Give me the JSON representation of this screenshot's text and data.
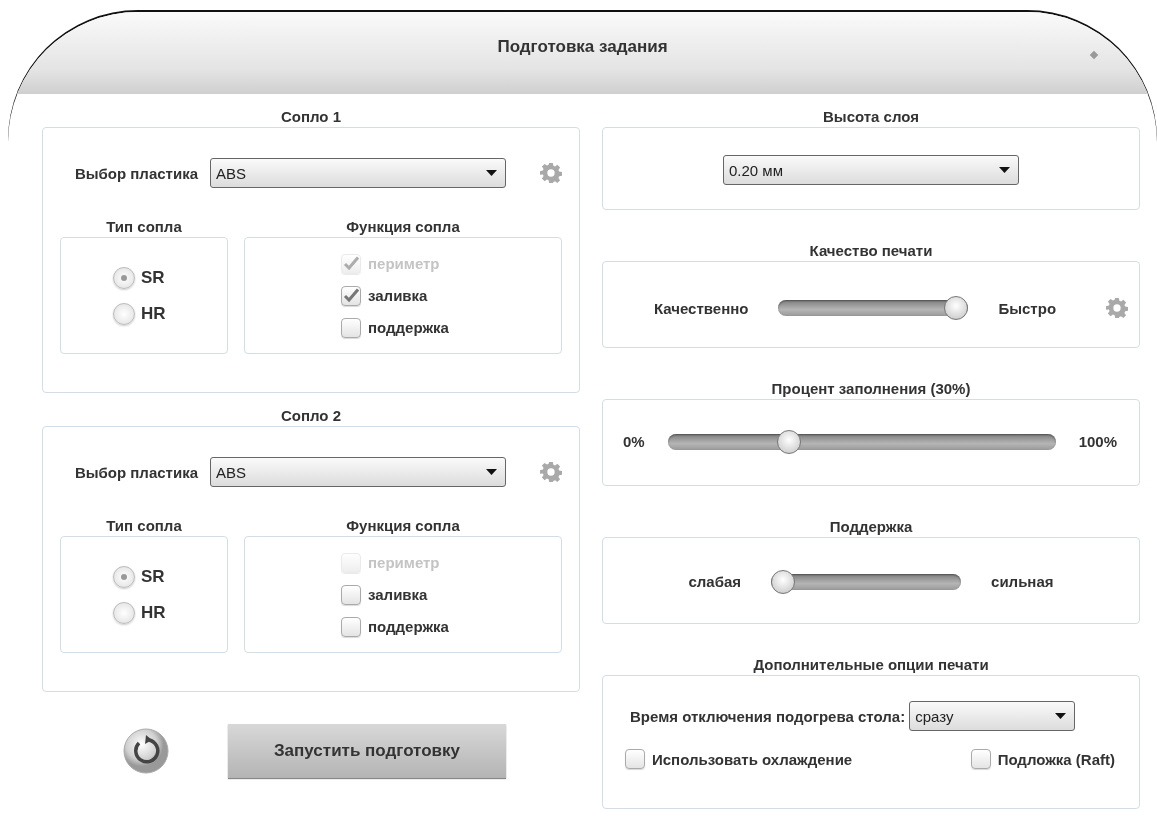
{
  "window": {
    "title": "Подготовка задания"
  },
  "nozzles": [
    {
      "title": "Сопло 1",
      "material_label": "Выбор пластика",
      "material": "ABS",
      "type_title": "Тип сопла",
      "types": [
        {
          "label": "SR",
          "selected": true
        },
        {
          "label": "HR",
          "selected": false
        }
      ],
      "function_title": "Функция сопла",
      "functions": [
        {
          "label": "периметр",
          "checked": true,
          "disabled": true
        },
        {
          "label": "заливка",
          "checked": true,
          "disabled": false
        },
        {
          "label": "поддержка",
          "checked": false,
          "disabled": false
        }
      ]
    },
    {
      "title": "Сопло 2",
      "material_label": "Выбор пластика",
      "material": "ABS",
      "type_title": "Тип сопла",
      "types": [
        {
          "label": "SR",
          "selected": true
        },
        {
          "label": "HR",
          "selected": false
        }
      ],
      "function_title": "Функция сопла",
      "functions": [
        {
          "label": "периметр",
          "checked": false,
          "disabled": true
        },
        {
          "label": "заливка",
          "checked": false,
          "disabled": false
        },
        {
          "label": "поддержка",
          "checked": false,
          "disabled": false
        }
      ]
    }
  ],
  "layer_height": {
    "title": "Высота слоя",
    "value": "0.20 мм"
  },
  "sliders": [
    {
      "title": "Качество печати",
      "min_label": "Качественно",
      "max_label": "Быстро",
      "level": 1.0
    },
    {
      "title": "Процент заполнения (30%)",
      "min_label": "0%",
      "max_label": "100%",
      "level": 0.3
    },
    {
      "title": "Поддержка",
      "min_label": "слабая",
      "max_label": "сильная",
      "level": 0.0
    }
  ],
  "extra_options": {
    "title": "Дополнительные опции печати",
    "bed_label": "Время отключения подогрева стола:",
    "bed_value": "сразу",
    "options": [
      {
        "label": "Использовать охлаждение",
        "checked": false
      },
      {
        "label": "Подложка (Raft)",
        "checked": false
      }
    ]
  },
  "actions": {
    "start_label": "Запустить подготовку"
  }
}
